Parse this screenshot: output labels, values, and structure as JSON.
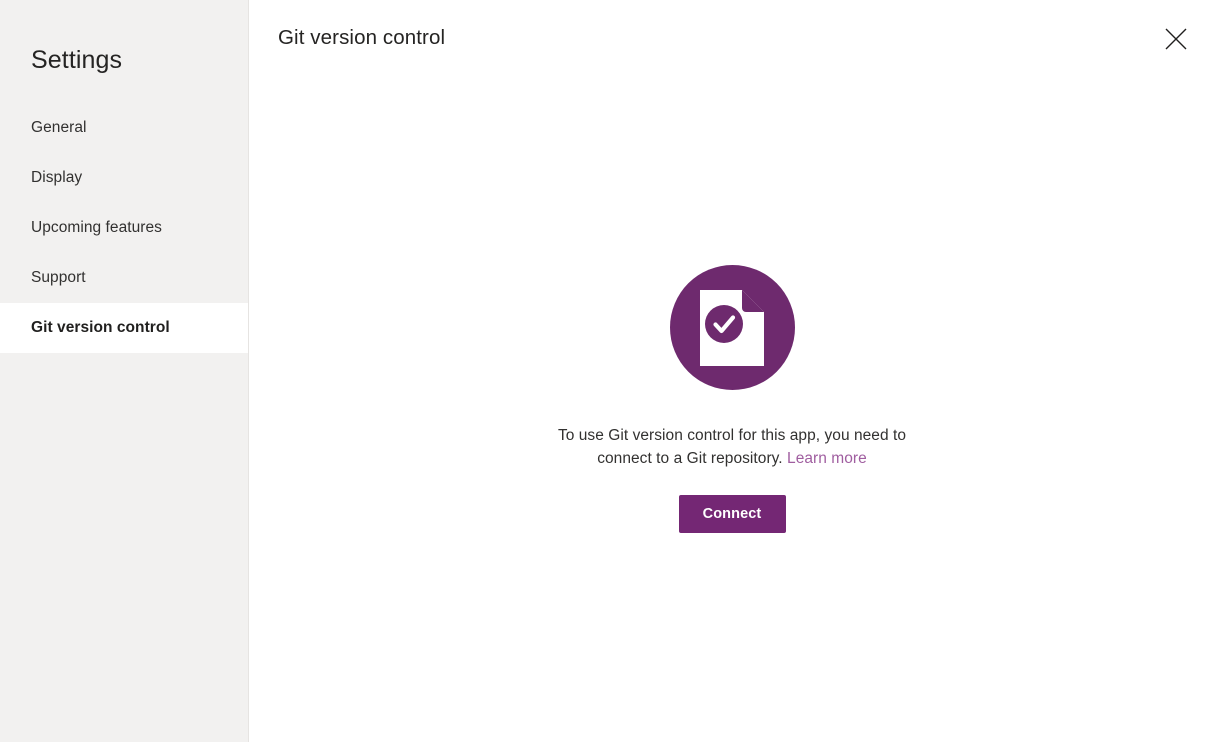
{
  "sidebar": {
    "title": "Settings",
    "items": [
      {
        "label": "General",
        "selected": false
      },
      {
        "label": "Display",
        "selected": false
      },
      {
        "label": "Upcoming features",
        "selected": false
      },
      {
        "label": "Support",
        "selected": false
      },
      {
        "label": "Git version control",
        "selected": true
      }
    ]
  },
  "header": {
    "title": "Git version control",
    "close_icon": "close-icon"
  },
  "empty_state": {
    "illustration_icon": "document-check-icon",
    "message": "To use Git version control for this app, you need to connect to a Git repository. ",
    "link_label": "Learn more",
    "button_label": "Connect"
  },
  "colors": {
    "accent_purple": "#742774",
    "illustration_purple": "#6e2a6e",
    "link_purple": "#a05ea0",
    "sidebar_background": "#f2f1f0",
    "main_background": "#ffffff",
    "text_primary": "#323130"
  }
}
